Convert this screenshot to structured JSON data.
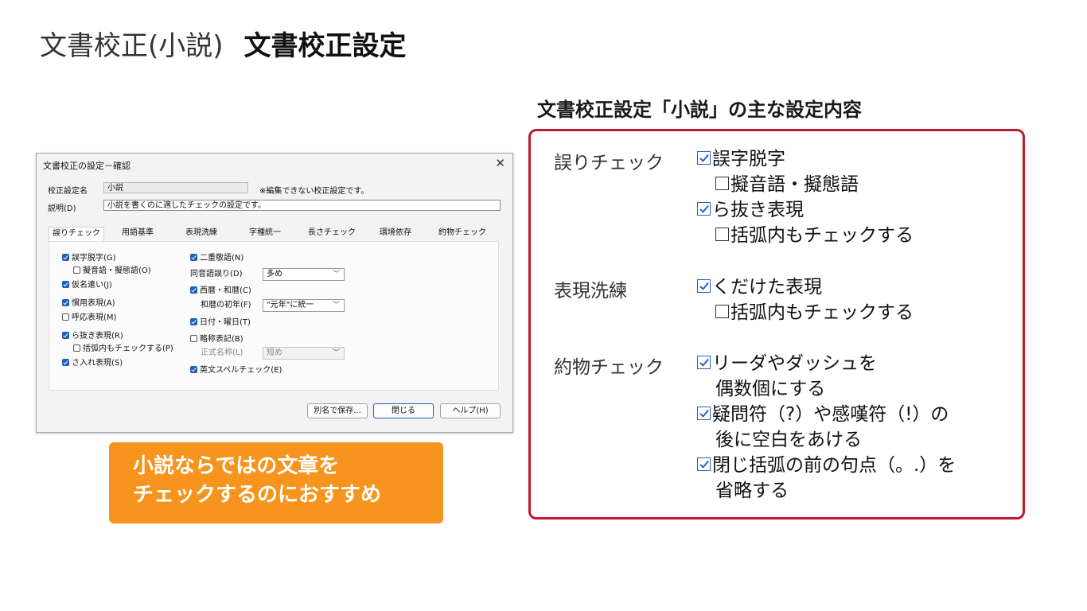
{
  "slide": {
    "title_sub": "文書校正(小説)",
    "title_main": "文書校正設定"
  },
  "dialog": {
    "title": "文書校正の設定－確認",
    "close_glyph": "✕",
    "setting_name_label": "校正設定名",
    "setting_name_value": "小説",
    "readonly_note": "※編集できない校正設定です。",
    "description_label": "説明(D)",
    "description_value": "小説を書くのに適したチェックの設定です。",
    "tabs": [
      "誤りチェック",
      "用語基準",
      "表現洗練",
      "字種統一",
      "長さチェック",
      "環境依存",
      "約物チェック"
    ],
    "left_checks": [
      {
        "label": "誤字脱字(G)",
        "checked": true
      },
      {
        "label": "擬音語・擬態語(O)",
        "checked": false
      },
      {
        "label": "仮名遣い(J)",
        "checked": true
      },
      {
        "label": "慣用表現(A)",
        "checked": true
      },
      {
        "label": "呼応表現(M)",
        "checked": false
      },
      {
        "label": "ら抜き表現(R)",
        "checked": true
      },
      {
        "label": "括弧内もチェックする(P)",
        "checked": false
      },
      {
        "label": "さ入れ表現(S)",
        "checked": true
      }
    ],
    "right": {
      "double_honorific": "二重敬語(N)",
      "homophone_label": "同音語誤り(D)",
      "homophone_value": "多め",
      "western_japanese": "西暦・和暦(C)",
      "first_year_label": "和暦の初年(F)",
      "first_year_value": "\"元年\"に統一",
      "date_weekday": "日付・曜日(T)",
      "abbreviation": "略称表記(B)",
      "official_name_label": "正式名称(L)",
      "official_name_value": "短め",
      "english_spell": "英文スペルチェック(E)"
    },
    "buttons": {
      "save_as": "別名で保存...",
      "close": "閉じる",
      "help": "ヘルプ(H)"
    }
  },
  "callout": {
    "line1": "小説ならではの文章を",
    "line2": "チェックするのにおすすめ"
  },
  "panel": {
    "heading": "文書校正設定「小説」の主な設定内容",
    "error_check": {
      "category": "誤りチェック",
      "item1": "誤字脱字",
      "item2": "擬音語・擬態語",
      "item3": "ら抜き表現",
      "item4": "括弧内もチェックする"
    },
    "refinement": {
      "category": "表現洗練",
      "item1": "くだけた表現",
      "item2": "括弧内もチェックする"
    },
    "punctuation": {
      "category": "約物チェック",
      "item1_line1": "リーダやダッシュを",
      "item1_line2": "偶数個にする",
      "item2_line1": "疑問符（?）や感嘆符（!）の",
      "item2_line2": "後に空白をあける",
      "item3_line1": "閉じ括弧の前の句点（。.）を",
      "item3_line2": "省略する"
    }
  }
}
